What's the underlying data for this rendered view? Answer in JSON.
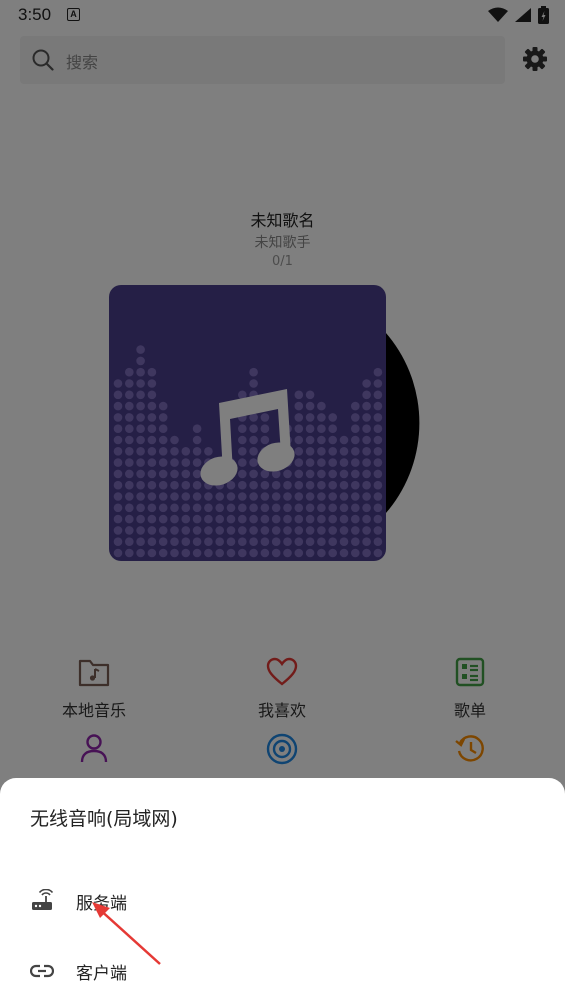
{
  "status_bar": {
    "time": "3:50",
    "a_badge": "A"
  },
  "search": {
    "placeholder": "搜索"
  },
  "player": {
    "title": "未知歌名",
    "artist": "未知歌手",
    "track_count": "0/1",
    "cover_color": "#4b3e8c"
  },
  "quick_actions": [
    {
      "label": "本地音乐",
      "icon": "folder-music-icon",
      "color": "#7a5f55"
    },
    {
      "label": "我喜欢",
      "icon": "heart-icon",
      "color": "#e53935"
    },
    {
      "label": "歌单",
      "icon": "playlist-icon",
      "color": "#43a047"
    },
    {
      "icon": "person-icon",
      "color": "#8e24aa"
    },
    {
      "icon": "disc-icon",
      "color": "#1e88e5"
    },
    {
      "icon": "history-icon",
      "color": "#fb8c00"
    }
  ],
  "sheet": {
    "title": "无线音响(局域网)",
    "items": [
      {
        "label": "服务端",
        "icon": "router-icon"
      },
      {
        "label": "客户端",
        "icon": "link-icon"
      }
    ]
  }
}
